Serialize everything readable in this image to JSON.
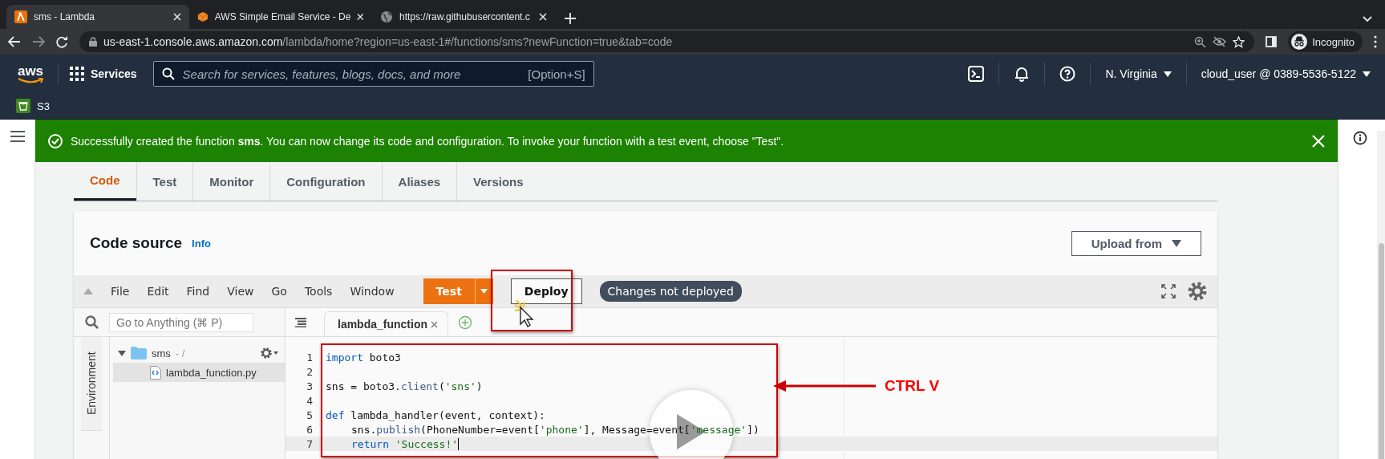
{
  "browser": {
    "tabs": [
      {
        "title": "sms - Lambda",
        "selected": true,
        "kind": "lambda"
      },
      {
        "title": "AWS Simple Email Service - De",
        "selected": false,
        "kind": "cube"
      },
      {
        "title": "https://raw.githubusercontent.c",
        "selected": false,
        "kind": "globe"
      }
    ],
    "address": {
      "host": "us-east-1.console.aws.amazon.com",
      "path": "/lambda/home?region=us-east-1#/functions/sms?newFunction=true&tab=code"
    },
    "profile": "Incognito"
  },
  "aws_nav": {
    "logo_text": "aws",
    "services": "Services",
    "search_placeholder": "Search for services, features, blogs, docs, and more",
    "search_shortcut": "[Option+S]",
    "region": "N. Virginia",
    "account": "cloud_user @ 0389-5536-5122",
    "favorites": [
      "S3"
    ]
  },
  "banner": {
    "message": "Successfully created the function **sms**. You can now change its code and configuration. To invoke your function with a test event, choose \"Test\"."
  },
  "tabs": [
    {
      "label": "Code",
      "selected": true
    },
    {
      "label": "Test",
      "selected": false
    },
    {
      "label": "Monitor",
      "selected": false
    },
    {
      "label": "Configuration",
      "selected": false
    },
    {
      "label": "Aliases",
      "selected": false
    },
    {
      "label": "Versions",
      "selected": false
    }
  ],
  "code_source": {
    "title": "Code source",
    "info": "Info",
    "upload_button": "Upload from",
    "menu": [
      "File",
      "Edit",
      "Find",
      "View",
      "Go",
      "Tools",
      "Window"
    ],
    "test_button": "Test",
    "deploy_button": "Deploy",
    "status_badge": "Changes not deployed",
    "go_to_placeholder": "Go to Anything (⌘ P)",
    "environment_tab": "Environment",
    "tree": [
      {
        "name": "sms",
        "suffix": " - /",
        "expanded": true,
        "children": [
          {
            "name": "lambda_function.py",
            "selected": true
          }
        ]
      }
    ],
    "editor_tab": "lambda_function",
    "lines": [
      {
        "number": "1",
        "current": false,
        "indented": false,
        "tokens": [
          {
            "kind": "kw",
            "text": "import"
          },
          {
            "kind": "plain",
            "text": " boto3"
          }
        ]
      },
      {
        "number": "2",
        "current": false
      },
      {
        "number": "3",
        "current": false,
        "indented": false,
        "tokens": [
          {
            "kind": "plain",
            "text": "sns = boto3."
          },
          {
            "kind": "fn",
            "text": "client"
          },
          {
            "kind": "plain",
            "text": "("
          },
          {
            "kind": "str",
            "text": "'sns'"
          },
          {
            "kind": "plain",
            "text": ")"
          }
        ]
      },
      {
        "number": "4",
        "current": false
      },
      {
        "number": "5",
        "current": false,
        "indented": false,
        "tokens": [
          {
            "kind": "kw",
            "text": "def"
          },
          {
            "kind": "plain",
            "text": " lambda_handler(event, context):"
          }
        ]
      },
      {
        "number": "6",
        "current": false,
        "indented": true,
        "tokens": [
          {
            "kind": "plain",
            "text": "sns."
          },
          {
            "kind": "fn",
            "text": "publish"
          },
          {
            "kind": "plain",
            "text": "(PhoneNumber=event["
          },
          {
            "kind": "str",
            "text": "'phone'"
          },
          {
            "kind": "plain",
            "text": "], Message=event["
          },
          {
            "kind": "str",
            "text": "'message'"
          },
          {
            "kind": "plain",
            "text": "])"
          }
        ]
      },
      {
        "number": "7",
        "current": true,
        "indented": true,
        "tokens": [
          {
            "kind": "kw",
            "text": "return"
          },
          {
            "kind": "str",
            "text": " 'Success!'"
          }
        ]
      }
    ]
  },
  "annotation": {
    "label": "CTRL V"
  }
}
